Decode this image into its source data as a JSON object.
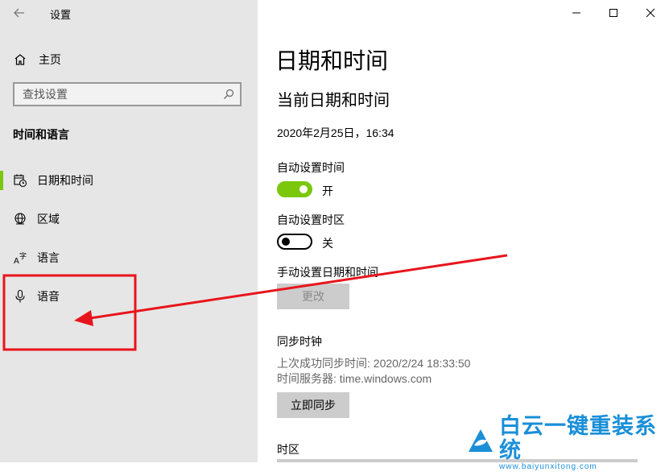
{
  "window": {
    "title": "设置",
    "controls": [
      "minimize-icon",
      "maximize-icon",
      "close-icon"
    ]
  },
  "sidebar": {
    "home_label": "主页",
    "search_placeholder": "查找设置",
    "section_title": "时间和语言",
    "items": [
      {
        "label": "日期和时间",
        "icon": "calendar-clock-icon",
        "active": true
      },
      {
        "label": "区域",
        "icon": "globe-icon",
        "active": false
      },
      {
        "label": "语言",
        "icon": "language-icon",
        "active": false
      },
      {
        "label": "语音",
        "icon": "microphone-icon",
        "active": false
      }
    ]
  },
  "main": {
    "page_title": "日期和时间",
    "current_section_title": "当前日期和时间",
    "current_datetime": "2020年2月25日，16:34",
    "auto_time": {
      "label": "自动设置时间",
      "state_text": "开",
      "on": true
    },
    "auto_timezone": {
      "label": "自动设置时区",
      "state_text": "关",
      "on": false
    },
    "manual": {
      "label": "手动设置日期和时间",
      "button": "更改"
    },
    "sync": {
      "title": "同步时钟",
      "last_sync": "上次成功同步时间: 2020/2/24 18:33:50",
      "server": "时间服务器: time.windows.com",
      "button": "立即同步"
    },
    "timezone_label": "时区"
  },
  "watermark": {
    "main": "白云一键重装系统",
    "sub": "www.baiyunxitong.com"
  },
  "colors": {
    "accent": "#7ac70c",
    "annotation_red": "#e8141b",
    "sidebar_bg": "#e6e6e6",
    "watermark_blue": "#1a8fd8"
  }
}
